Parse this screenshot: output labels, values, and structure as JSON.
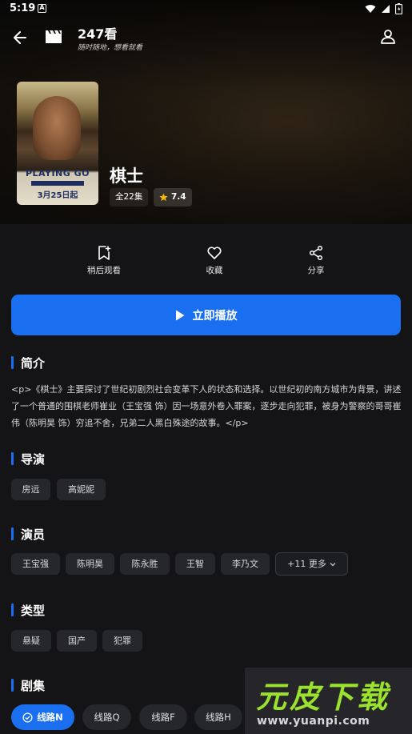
{
  "status_bar": {
    "time": "5:19",
    "badge": "A"
  },
  "header": {
    "title": "247看",
    "subtitle": "随时随地，想看就看"
  },
  "movie": {
    "title": "棋士",
    "episodes": "全22集",
    "rating": "7.4",
    "poster": {
      "title_text": "PLAYING GO",
      "date_text": "3月25日起"
    }
  },
  "actions": [
    {
      "label": "稍后观看",
      "icon": "bookmark-add-icon"
    },
    {
      "label": "收藏",
      "icon": "heart-icon"
    },
    {
      "label": "分享",
      "icon": "share-icon"
    }
  ],
  "play_button": {
    "label": "立即播放"
  },
  "sections": {
    "synopsis": {
      "title": "简介",
      "text": "<p>《棋士》主要探讨了世纪初剧烈社会变革下人的状态和选择。以世纪初的南方城市为背景，讲述了一个普通的围棋老师崔业（王宝强 饰）因一场意外卷入罪案，逐步走向犯罪，被身为警察的哥哥崔伟（陈明昊 饰）穷追不舍，兄弟二人黑白殊途的故事。</p>"
    },
    "director": {
      "title": "导演",
      "items": [
        "房远",
        "高妮妮"
      ]
    },
    "cast": {
      "title": "演员",
      "items": [
        "王宝强",
        "陈明昊",
        "陈永胜",
        "王智",
        "李乃文"
      ],
      "more": "+11 更多"
    },
    "genre": {
      "title": "类型",
      "items": [
        "悬疑",
        "国产",
        "犯罪"
      ]
    },
    "episodes": {
      "title": "剧集",
      "lines": [
        "线路N",
        "线路Q",
        "线路F",
        "线路H"
      ],
      "active_index": 0
    }
  },
  "watermark": {
    "text": "元皮下载",
    "url": "www.yuanpi.com"
  },
  "colors": {
    "accent": "#1a6ff0",
    "background": "#141416",
    "chip": "#26272b"
  }
}
